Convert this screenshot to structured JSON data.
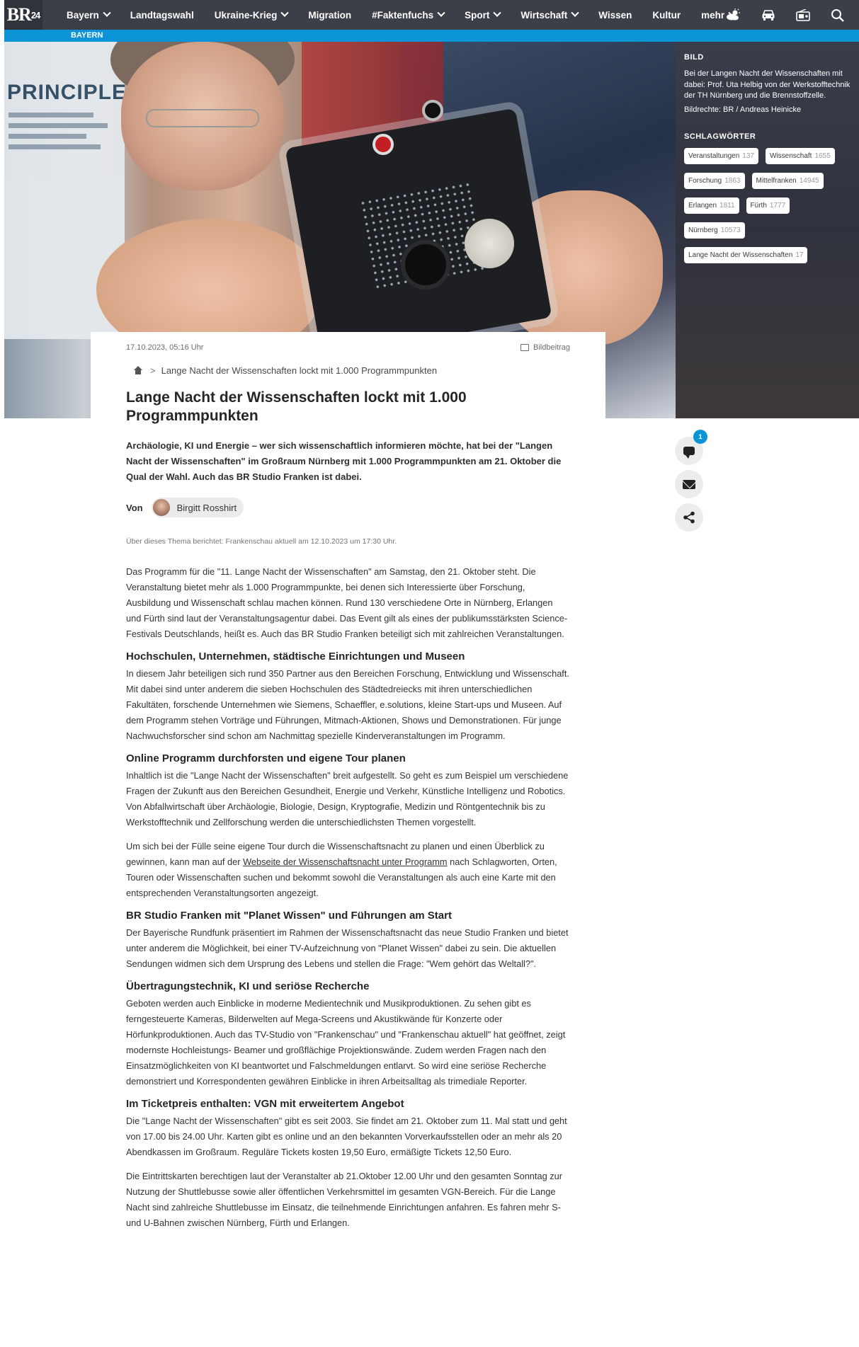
{
  "header": {
    "logo": "BR",
    "logo_sup": "24",
    "nav": [
      {
        "label": "Bayern",
        "chevron": true
      },
      {
        "label": "Landtagswahl",
        "chevron": false
      },
      {
        "label": "Ukraine-Krieg",
        "chevron": true
      },
      {
        "label": "Migration",
        "chevron": false
      },
      {
        "label": "#Faktenfuchs",
        "chevron": true
      },
      {
        "label": "Sport",
        "chevron": true
      },
      {
        "label": "Wirtschaft",
        "chevron": true
      },
      {
        "label": "Wissen",
        "chevron": false
      },
      {
        "label": "Kultur",
        "chevron": false
      },
      {
        "label": "mehr",
        "chevron": true
      }
    ],
    "icons": [
      "weather-icon",
      "traffic-car-icon",
      "radio-icon",
      "search-icon"
    ],
    "region": "BAYERN"
  },
  "side": {
    "image_heading": "BILD",
    "caption": "Bei der Langen Nacht der Wissenschaften mit dabei: Prof. Uta Helbig von der Werkstofftechnik der TH Nürnberg und die Brennstoffzelle.",
    "rights": "Bildrechte: BR / Andreas Heinicke",
    "tags_heading": "SCHLAGWÖRTER",
    "tags": [
      {
        "label": "Veranstaltungen",
        "count": "137"
      },
      {
        "label": "Wissenschaft",
        "count": "1655"
      },
      {
        "label": "Forschung",
        "count": "1863"
      },
      {
        "label": "Mittelfranken",
        "count": "14945"
      },
      {
        "label": "Erlangen",
        "count": "1811"
      },
      {
        "label": "Fürth",
        "count": "1777"
      },
      {
        "label": "Nürnberg",
        "count": "10573"
      },
      {
        "label": "Lange Nacht der Wissenschaften",
        "count": "17"
      }
    ]
  },
  "hero": {
    "poster_text": "PRINCIPLE"
  },
  "article": {
    "date": "17.10.2023, 05:16 Uhr",
    "kind": "Bildbeitrag",
    "breadcrumb": "Lange Nacht der Wissenschaften lockt mit 1.000 Programmpunkten",
    "title": "Lange Nacht der Wissenschaften lockt mit 1.000 Programmpunkten",
    "lead": "Archäologie, KI und Energie – wer sich wissenschaftlich informieren möchte, hat bei der \"Langen Nacht der Wissenschaften\" im Großraum Nürnberg mit 1.000 Programmpunkten am 21. Oktober die Qual der Wahl. Auch das BR Studio Franken ist dabei.",
    "by": "Von",
    "author": "Birgitt Rosshirt",
    "note": "Über dieses Thema berichtet: Frankenschau aktuell am 12.10.2023 um 17:30 Uhr.",
    "p1": "Das Programm für die \"11. Lange Nacht der Wissenschaften\" am Samstag, den 21. Oktober steht. Die Veranstaltung bietet mehr als 1.000 Programmpunkte, bei denen sich Interessierte über Forschung, Ausbildung und Wissenschaft schlau machen können. Rund 130 verschiedene Orte in Nürnberg, Erlangen und Fürth sind laut der Veranstaltungsagentur dabei. Das Event gilt als eines der publikumsstärksten Science-Festivals Deutschlands, heißt es. Auch das BR Studio Franken beteiligt sich mit zahlreichen Veranstaltungen.",
    "h2a": "Hochschulen, Unternehmen, städtische Einrichtungen und Museen",
    "p2": "In diesem Jahr beteiligen sich rund 350 Partner aus den Bereichen Forschung, Entwicklung und Wissenschaft. Mit dabei sind unter anderem die sieben Hochschulen des Städtedreiecks mit ihren unterschiedlichen Fakultäten, forschende Unternehmen wie Siemens, Schaeffler, e.solutions, kleine Start-ups und Museen. Auf dem Programm stehen Vorträge und Führungen, Mitmach-Aktionen, Shows und Demonstrationen. Für junge Nachwuchsforscher sind schon am Nachmittag spezielle Kinderveranstaltungen im Programm.",
    "h2b": "Online Programm durchforsten und eigene Tour planen",
    "p3": "Inhaltlich ist die \"Lange Nacht der Wissenschaften\" breit aufgestellt. So geht es zum Beispiel um verschiedene Fragen der Zukunft aus den Bereichen Gesundheit, Energie und Verkehr, Künstliche Intelligenz und Robotics. Von Abfallwirtschaft über Archäologie, Biologie, Design, Kryptografie, Medizin und Röntgentechnik bis zu Werkstofftechnik und Zellforschung werden die unterschiedlichsten Themen vorgestellt.",
    "p4_before": "Um sich bei der Fülle seine eigene Tour durch die Wissenschaftsnacht zu planen und einen Überblick zu gewinnen, kann man auf der ",
    "p4_link": "Webseite der Wissenschaftsnacht unter Programm",
    "p4_after": " nach Schlagworten, Orten, Touren oder Wissenschaften suchen und bekommt sowohl die Veranstaltungen als auch eine Karte mit den entsprechenden Veranstaltungsorten angezeigt.",
    "h2c": "BR Studio Franken mit \"Planet Wissen\" und Führungen am Start",
    "p5": "Der Bayerische Rundfunk präsentiert im Rahmen der Wissenschaftsnacht das neue Studio Franken und bietet unter anderem die Möglichkeit, bei einer TV-Aufzeichnung von \"Planet Wissen\" dabei zu sein. Die aktuellen Sendungen widmen sich dem Ursprung des Lebens und stellen die Frage: \"Wem gehört das Weltall?\".",
    "h2d": "Übertragungstechnik, KI und seriöse Recherche",
    "p6": "Geboten werden auch Einblicke in moderne Medientechnik und Musikproduktionen. Zu sehen gibt es ferngesteuerte Kameras, Bilderwelten auf Mega-Screens und Akustikwände für Konzerte oder Hörfunkproduktionen. Auch das TV-Studio von \"Frankenschau\" und \"Frankenschau aktuell\" hat geöffnet, zeigt modernste Hochleistungs- Beamer und großflächige Projektionswände. Zudem werden Fragen nach den Einsatzmöglichkeiten von KI beantwortet und Falschmeldungen entlarvt. So wird eine seriöse Recherche demonstriert und Korrespondenten gewähren Einblicke in ihren Arbeitsalltag als trimediale Reporter.",
    "h2e": "Im Ticketpreis enthalten: VGN mit erweitertem Angebot",
    "p7": "Die \"Lange Nacht der Wissenschaften\" gibt es seit 2003. Sie findet am 21. Oktober zum 11. Mal statt und geht von 17.00 bis 24.00 Uhr. Karten gibt es online und an den bekannten Vorverkaufsstellen oder an mehr als 20 Abendkassen im Großraum. Reguläre Tickets kosten 19,50 Euro, ermäßigte Tickets 12,50 Euro.",
    "p8": "Die Eintrittskarten berechtigen laut der Veranstalter ab 21.Oktober 12.00 Uhr und den gesamten Sonntag zur Nutzung der Shuttlebusse sowie aller öffentlichen Verkehrsmittel im gesamten VGN-Bereich. Für die Lange Nacht sind zahlreiche Shuttlebusse im Einsatz, die teilnehmende Einrichtungen anfahren. Es fahren mehr S- und U-Bahnen zwischen Nürnberg, Fürth und Erlangen."
  },
  "actions": {
    "comment_count": "1"
  }
}
